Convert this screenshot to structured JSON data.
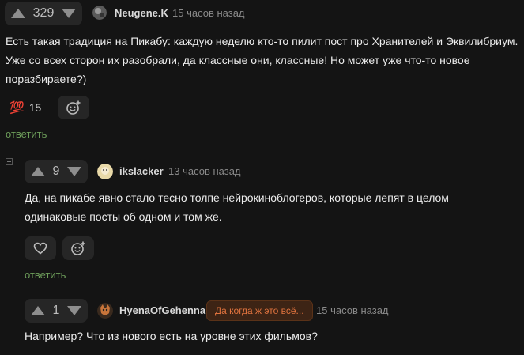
{
  "comments": [
    {
      "votes": "329",
      "username": "Neugene.K",
      "time": "15 часов назад",
      "text": "Есть такая традиция на Пикабу: каждую неделю кто-то пилит пост про Хранителей и Эквилибриум. Уже со всех сторон их разобрали, да классные они, классные! Но может уже что-то новое поразбираете?)",
      "reaction_emoji": "💯",
      "reaction_count": "15",
      "reply_label": "ответить"
    },
    {
      "votes": "9",
      "username": "ikslacker",
      "time": "13 часов назад",
      "text": "Да, на пикабе явно стало тесно толпе нейрокиноблогеров, которые лепят в целом одинаковые посты об одном и том же.",
      "reply_label": "ответить"
    },
    {
      "votes": "1",
      "username": "HyenaOfGehenna",
      "badge": "Да когда ж это всё...",
      "time": "15 часов назад",
      "text": "Например? Что из нового есть на уровне этих фильмов?"
    }
  ],
  "colors": {
    "background": "#141414",
    "panel": "#262626",
    "reply_green": "#6d9d5a",
    "badge_orange": "#e0733e"
  }
}
